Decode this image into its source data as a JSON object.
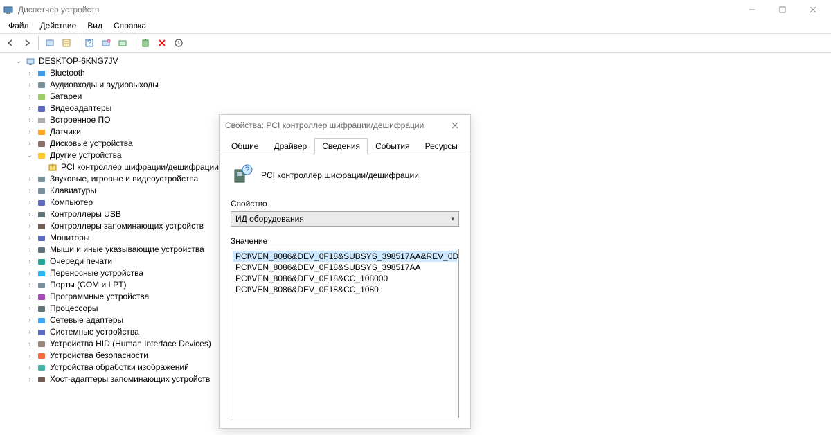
{
  "window": {
    "title": "Диспетчер устройств"
  },
  "menu": {
    "file": "Файл",
    "action": "Действие",
    "view": "Вид",
    "help": "Справка"
  },
  "tree": {
    "root": "DESKTOP-6KNG7JV",
    "items": [
      {
        "label": "Bluetooth",
        "icon": "bluetooth"
      },
      {
        "label": "Аудиовходы и аудиовыходы",
        "icon": "audio"
      },
      {
        "label": "Батареи",
        "icon": "battery"
      },
      {
        "label": "Видеоадаптеры",
        "icon": "display"
      },
      {
        "label": "Встроенное ПО",
        "icon": "chip"
      },
      {
        "label": "Датчики",
        "icon": "sensor"
      },
      {
        "label": "Дисковые устройства",
        "icon": "disk"
      },
      {
        "label": "Другие устройства",
        "icon": "other",
        "expanded": true
      },
      {
        "label": "Звуковые, игровые и видеоустройства",
        "icon": "audio"
      },
      {
        "label": "Клавиатуры",
        "icon": "keyboard"
      },
      {
        "label": "Компьютер",
        "icon": "computer"
      },
      {
        "label": "Контроллеры USB",
        "icon": "usb"
      },
      {
        "label": "Контроллеры запоминающих устройств",
        "icon": "storage"
      },
      {
        "label": "Мониторы",
        "icon": "monitor"
      },
      {
        "label": "Мыши и иные указывающие устройства",
        "icon": "mouse"
      },
      {
        "label": "Очереди печати",
        "icon": "printer"
      },
      {
        "label": "Переносные устройства",
        "icon": "portable"
      },
      {
        "label": "Порты (COM и LPT)",
        "icon": "port"
      },
      {
        "label": "Программные устройства",
        "icon": "software"
      },
      {
        "label": "Процессоры",
        "icon": "cpu"
      },
      {
        "label": "Сетевые адаптеры",
        "icon": "network"
      },
      {
        "label": "Системные устройства",
        "icon": "system"
      },
      {
        "label": "Устройства HID (Human Interface Devices)",
        "icon": "hid"
      },
      {
        "label": "Устройства безопасности",
        "icon": "security"
      },
      {
        "label": "Устройства обработки изображений",
        "icon": "imaging"
      },
      {
        "label": "Хост-адаптеры запоминающих устройств",
        "icon": "storage-host"
      }
    ],
    "other_child": "PCI контроллер шифрации/дешифрации"
  },
  "dialog": {
    "title": "Свойства: PCI контроллер шифрации/дешифрации",
    "tabs": {
      "general": "Общие",
      "driver": "Драйвер",
      "details": "Сведения",
      "events": "События",
      "resources": "Ресурсы"
    },
    "device_name": "PCI контроллер шифрации/дешифрации",
    "property_label": "Свойство",
    "property_value": "ИД оборудования",
    "value_label": "Значение",
    "values": [
      "PCI\\VEN_8086&DEV_0F18&SUBSYS_398517AA&REV_0D",
      "PCI\\VEN_8086&DEV_0F18&SUBSYS_398517AA",
      "PCI\\VEN_8086&DEV_0F18&CC_108000",
      "PCI\\VEN_8086&DEV_0F18&CC_1080"
    ]
  }
}
